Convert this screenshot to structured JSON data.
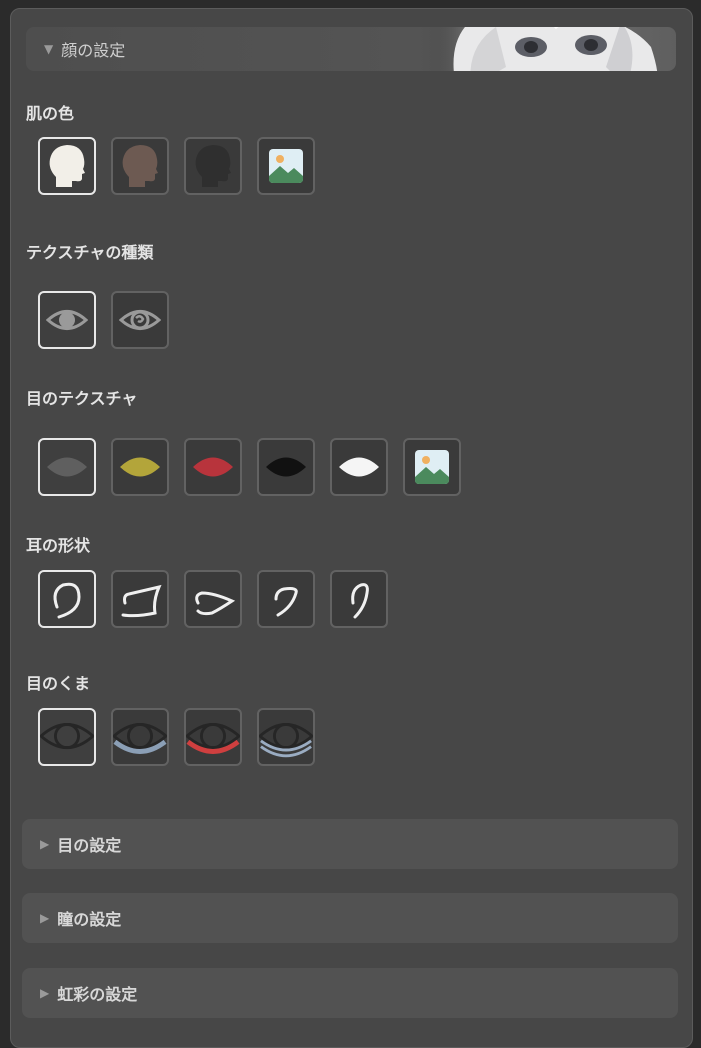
{
  "face_settings": {
    "header": "顔の設定",
    "sections": {
      "skin": {
        "label": "肌の色"
      },
      "texture_type": {
        "label": "テクスチャの種類"
      },
      "eye_texture": {
        "label": "目のテクスチャ"
      },
      "ear_shape": {
        "label": "耳の形状"
      },
      "dark_circles": {
        "label": "目のくま"
      }
    }
  },
  "collapsed_sections": {
    "eye": "目の設定",
    "pupil": "瞳の設定",
    "iris": "虹彩の設定"
  },
  "colors": {
    "skin_light": "#f2efe8",
    "skin_brown": "#6d5a52",
    "skin_dark": "#2f2f2f",
    "eye_gray": "#5f5f5f",
    "eye_yellow": "#b3a53a",
    "eye_red": "#b8343c",
    "eye_black": "#111111",
    "eye_white": "#f5f5f5"
  }
}
